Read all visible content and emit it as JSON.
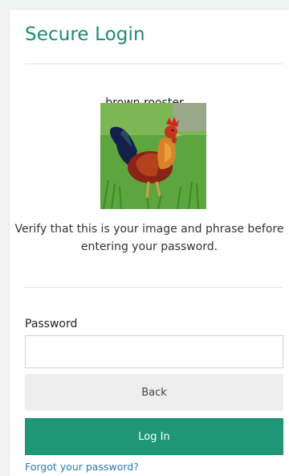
{
  "title": "Secure Login",
  "security_phrase": "brown rooster",
  "security_image": {
    "description_icon": "rooster-image"
  },
  "verify_text": "Verify that this is your image and phrase before entering your password.",
  "password": {
    "label": "Password",
    "value": "",
    "placeholder": ""
  },
  "buttons": {
    "back": "Back",
    "login": "Log In"
  },
  "forgot_link": "Forgot your password?",
  "colors": {
    "accent": "#1f9676",
    "title": "#1e8c6e",
    "link": "#2b7bb9"
  }
}
